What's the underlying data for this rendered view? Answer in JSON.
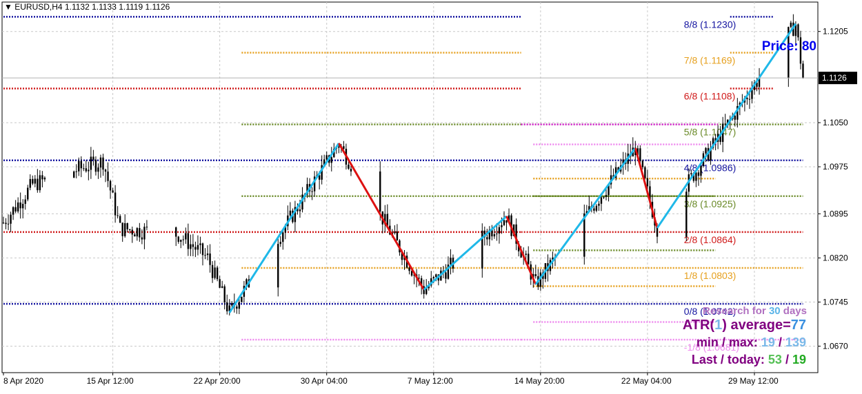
{
  "header": {
    "symbol": "EURUSD,H4",
    "ohlc": "1.1132 1.1133 1.1119 1.1126"
  },
  "chart_data": {
    "type": "candlestick",
    "symbol": "EURUSD",
    "timeframe": "H4",
    "current_price": 1.1126,
    "ylim": [
      1.0625,
      1.1255
    ],
    "y_ticks": [
      "1.1205",
      "1.1126",
      "1.1050",
      "1.0975",
      "1.0895",
      "1.0820",
      "1.0745",
      "1.0670"
    ],
    "x_ticks": [
      "8 Apr 2020",
      "15 Apr 12:00",
      "22 Apr 20:00",
      "30 Apr 04:00",
      "7 May 12:00",
      "14 May 20:00",
      "22 May 04:00",
      "29 May 12:00"
    ],
    "grid": true,
    "murrey_levels": [
      {
        "label": "8/8 (1.1230)",
        "value": 1.123,
        "color": "#1414a0"
      },
      {
        "label": "7/8 (1.1169)",
        "value": 1.1169,
        "color": "#e6a01e"
      },
      {
        "label": "6/8 (1.1108)",
        "value": 1.1108,
        "color": "#d01a1a"
      },
      {
        "label": "5/8 (1.1047)",
        "value": 1.1047,
        "color": "#6a8a28"
      },
      {
        "label": "4/8 (1.0986)",
        "value": 1.0986,
        "color": "#1414a0"
      },
      {
        "label": "3/8 (1.0925)",
        "value": 1.0925,
        "color": "#6a8a28"
      },
      {
        "label": "2/8 (1.0864)",
        "value": 1.0864,
        "color": "#d01a1a"
      },
      {
        "label": "1/8 (1.0803)",
        "value": 1.0803,
        "color": "#e6a01e"
      },
      {
        "label": "0/8 (1.0742)",
        "value": 1.0742,
        "color": "#1414a0"
      },
      {
        "label": "-1/8 (1.0681)",
        "value": 1.0681,
        "color": "#ee88ee"
      }
    ],
    "zigzag": [
      {
        "t": "23 Apr 12:00",
        "price": 1.0727
      },
      {
        "t": "1 May 00:00",
        "price": 1.1015
      },
      {
        "t": "6 May 20:00",
        "price": 1.0766
      },
      {
        "t": "12 May 12:00",
        "price": 1.0891
      },
      {
        "t": "14 May 12:00",
        "price": 1.0775
      },
      {
        "t": "21 May 08:00",
        "price": 1.1007
      },
      {
        "t": "22 May 20:00",
        "price": 1.0871
      },
      {
        "t": "1 Jun 08:00",
        "price": 1.1218
      }
    ],
    "zigzag_colors": {
      "up": "#1fb8e8",
      "down": "#dd1111"
    }
  },
  "info": {
    "price_label": "Price:",
    "price_value": "80",
    "research_prefix": "Research for",
    "research_days": "30",
    "research_suffix": "days",
    "atr_prefix": "ATR(",
    "atr_period": "1",
    "atr_suffix": ") average=",
    "atr_average": "77",
    "minmax_label": "min / max:",
    "min": "19",
    "sep": "/",
    "max": "139",
    "last_label": "Last / today:",
    "last": "53",
    "today": "19"
  }
}
